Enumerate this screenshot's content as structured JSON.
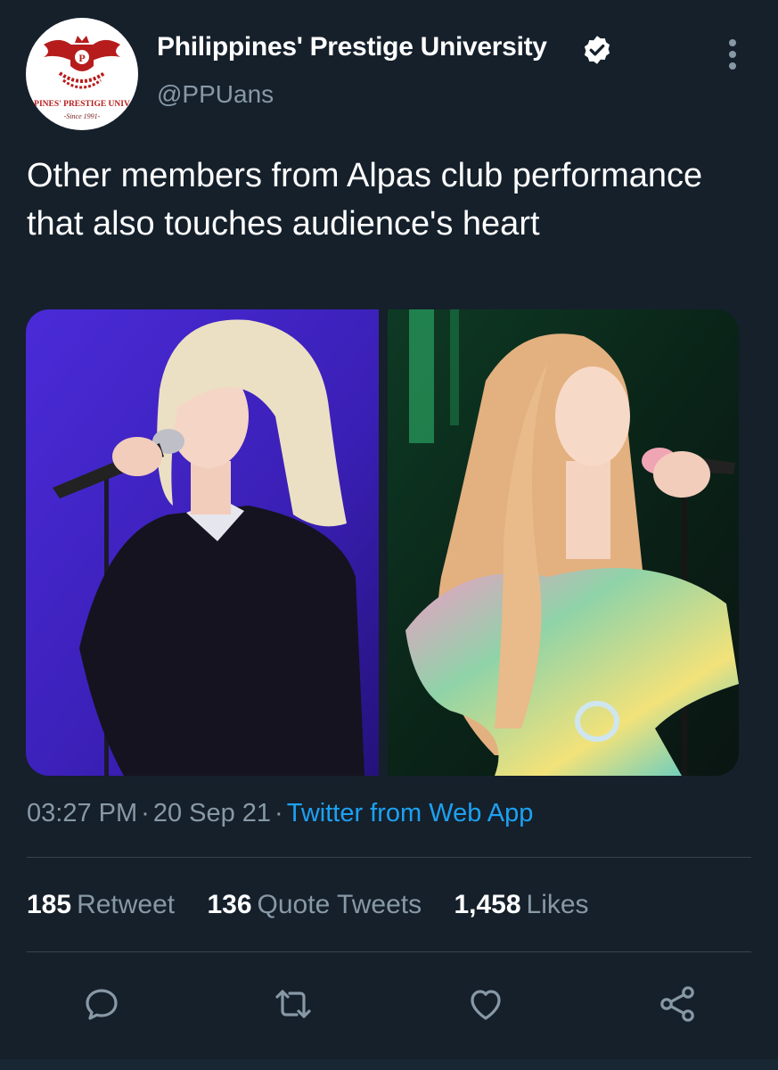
{
  "account": {
    "display_name": "Philippines' Prestige University",
    "handle": "@PPUans",
    "verified": true,
    "avatar": {
      "icon": "university-logo",
      "logo_text": "PINES' PRESTIGE UNIV",
      "logo_since": "-Since 1991-"
    }
  },
  "tweet": {
    "text": "Other members from Alpas club performance that also touches audience's heart",
    "time": "03:27 PM",
    "date": "20 Sep 21",
    "source": "Twitter from Web App",
    "images": [
      {
        "description": "singer-purple-background"
      },
      {
        "description": "singer-green-background"
      }
    ]
  },
  "stats": {
    "retweets": {
      "value": "185",
      "label": "Retweet"
    },
    "quotes": {
      "value": "136",
      "label": "Quote Tweets"
    },
    "likes": {
      "value": "1,458",
      "label": "Likes"
    }
  },
  "actions": [
    "reply-icon",
    "retweet-icon",
    "like-icon",
    "share-icon"
  ],
  "colors": {
    "background": "#15202b",
    "secondary_text": "#8899a6",
    "link": "#1da1f2",
    "divider": "#38444d"
  }
}
